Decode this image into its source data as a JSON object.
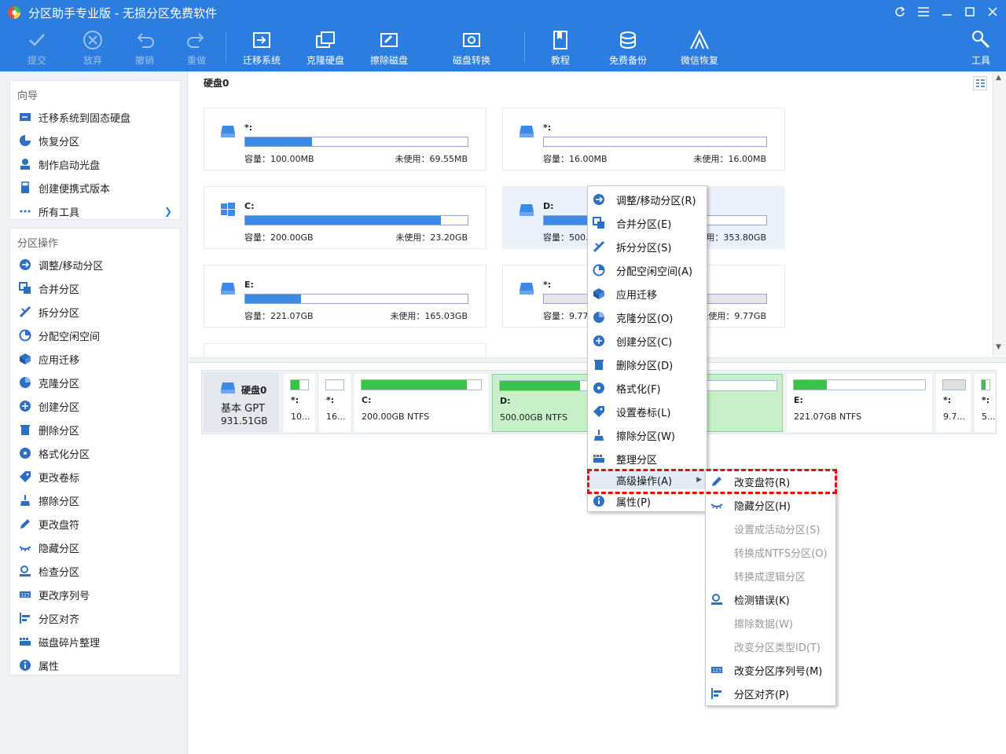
{
  "app": {
    "title": "分区助手专业版 - 无损分区免费软件"
  },
  "toolbar": {
    "buttons": [
      {
        "label": "提交",
        "icon": "check-icon",
        "enabled": false
      },
      {
        "label": "放弃",
        "icon": "cancel-icon",
        "enabled": false
      },
      {
        "label": "撤销",
        "icon": "undo-icon",
        "enabled": false
      },
      {
        "label": "重做",
        "icon": "redo-icon",
        "enabled": false
      },
      {
        "label": "迁移系统",
        "icon": "migrate-os-icon",
        "enabled": true
      },
      {
        "label": "克隆硬盘",
        "icon": "clone-disk-icon",
        "enabled": true
      },
      {
        "label": "擦除磁盘",
        "icon": "wipe-disk-icon",
        "enabled": true
      },
      {
        "label": "磁盘转换",
        "icon": "disk-convert-icon",
        "enabled": true
      },
      {
        "label": "教程",
        "icon": "tutorial-icon",
        "enabled": true
      },
      {
        "label": "免费备份",
        "icon": "backup-icon",
        "enabled": true
      },
      {
        "label": "微信恢复",
        "icon": "wechat-recovery-icon",
        "enabled": true
      },
      {
        "label": "工具",
        "icon": "tools-icon",
        "enabled": true
      }
    ]
  },
  "sidebar": {
    "wizard_title": "向导",
    "wizard_items": [
      {
        "label": "迁移系统到固态硬盘"
      },
      {
        "label": "恢复分区"
      },
      {
        "label": "制作启动光盘"
      },
      {
        "label": "创建便携式版本"
      },
      {
        "label": "所有工具"
      }
    ],
    "ops_title": "分区操作",
    "ops_items": [
      {
        "label": "调整/移动分区"
      },
      {
        "label": "合并分区"
      },
      {
        "label": "拆分分区"
      },
      {
        "label": "分配空闲空间"
      },
      {
        "label": "应用迁移"
      },
      {
        "label": "克隆分区"
      },
      {
        "label": "创建分区"
      },
      {
        "label": "删除分区"
      },
      {
        "label": "格式化分区"
      },
      {
        "label": "更改卷标"
      },
      {
        "label": "擦除分区"
      },
      {
        "label": "更改盘符"
      },
      {
        "label": "隐藏分区"
      },
      {
        "label": "检查分区"
      },
      {
        "label": "更改序列号"
      },
      {
        "label": "分区对齐"
      },
      {
        "label": "磁盘碎片整理"
      },
      {
        "label": "属性"
      }
    ]
  },
  "main": {
    "disk_title": "硬盘0",
    "cards": [
      {
        "name": "*:",
        "capacity": "容量：100.00MB",
        "unused": "未使用：69.55MB",
        "used_fraction": 0.3
      },
      {
        "name": "*:",
        "capacity": "容量：16.00MB",
        "unused": "未使用：16.00MB",
        "used_fraction": 0.0
      },
      {
        "name": "C:",
        "capacity": "容量：200.00GB",
        "unused": "未使用：23.20GB",
        "used_fraction": 0.88
      },
      {
        "name": "D:",
        "capacity": "容量：500.0",
        "unused": "使用：353.80GB",
        "used_fraction": 0.29
      },
      {
        "name": "E:",
        "capacity": "容量：221.07GB",
        "unused": "未使用：165.03GB",
        "used_fraction": 0.25
      },
      {
        "name": "*:",
        "capacity": "容量：9.77",
        "unused": "未使用：9.77GB",
        "used_fraction": 0.0
      }
    ],
    "diskmap": {
      "name": "硬盘0",
      "type": "基本 GPT",
      "size": "931.51GB",
      "blocks": [
        {
          "name": "*:",
          "size": "10...",
          "used_fraction": 0.5
        },
        {
          "name": "*:",
          "size": "16...",
          "used_fraction": 0.0
        },
        {
          "name": "C:",
          "size": "200.00GB NTFS",
          "used_fraction": 0.88
        },
        {
          "name": "D:",
          "size": "500.00GB NTFS",
          "used_fraction": 0.29
        },
        {
          "name": "E:",
          "size": "221.07GB NTFS",
          "used_fraction": 0.25
        },
        {
          "name": "*:",
          "size": "9.7...",
          "used_fraction": 0.0
        },
        {
          "name": "*:",
          "size": "5...",
          "used_fraction": 0.5
        }
      ]
    }
  },
  "context_menu": {
    "items": [
      {
        "label": "调整/移动分区(R)",
        "icon": "resize-icon"
      },
      {
        "label": "合并分区(E)",
        "icon": "merge-icon"
      },
      {
        "label": "拆分分区(S)",
        "icon": "split-icon"
      },
      {
        "label": "分配空闲空间(A)",
        "icon": "allocate-icon"
      },
      {
        "label": "应用迁移",
        "icon": "app-migrate-icon"
      },
      {
        "label": "克隆分区(O)",
        "icon": "clone-icon"
      },
      {
        "label": "创建分区(C)",
        "icon": "create-icon"
      },
      {
        "label": "删除分区(D)",
        "icon": "delete-icon"
      },
      {
        "label": "格式化(F)",
        "icon": "format-icon"
      },
      {
        "label": "设置卷标(L)",
        "icon": "label-icon"
      },
      {
        "label": "擦除分区(W)",
        "icon": "wipe-icon"
      },
      {
        "label": "整理分区",
        "icon": "defrag-icon"
      },
      {
        "label": "高级操作(A)",
        "icon": "",
        "submenu": true
      },
      {
        "label": "属性(P)",
        "icon": "info-icon"
      }
    ]
  },
  "submenu": {
    "items": [
      {
        "label": "改变盘符(R)",
        "icon": "pencil-icon",
        "enabled": true
      },
      {
        "label": "隐藏分区(H)",
        "icon": "hide-eye-icon",
        "enabled": true
      },
      {
        "label": "设置成活动分区(S)",
        "icon": "",
        "enabled": false
      },
      {
        "label": "转换成NTFS分区(O)",
        "icon": "",
        "enabled": false
      },
      {
        "label": "转换成逻辑分区",
        "icon": "",
        "enabled": false
      },
      {
        "label": "检测错误(K)",
        "icon": "check-disk-icon",
        "enabled": true
      },
      {
        "label": "擦除数据(W)",
        "icon": "",
        "enabled": false
      },
      {
        "label": "改变分区类型ID(T)",
        "icon": "",
        "enabled": false
      },
      {
        "label": "改变分区序列号(M)",
        "icon": "serial-icon",
        "enabled": true
      },
      {
        "label": "分区对齐(P)",
        "icon": "align-icon",
        "enabled": true
      }
    ]
  },
  "colors": {
    "titlebar": "#2c7de0",
    "accent": "#3c8ae6",
    "green": "#38c24a",
    "highlight": "#e01010"
  }
}
